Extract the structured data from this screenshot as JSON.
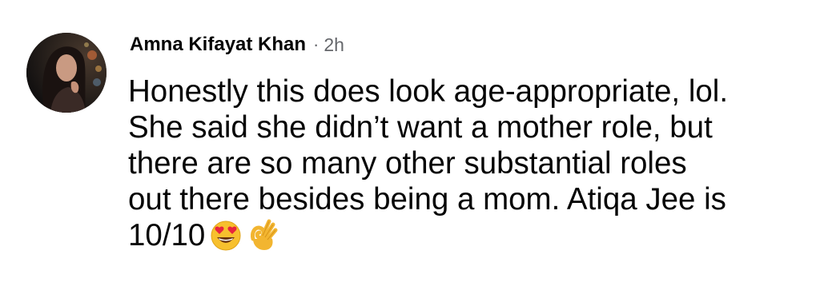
{
  "comment": {
    "author": "Amna Kifayat Khan",
    "separator": "·",
    "time": "2h",
    "lines": [
      "Honestly this does look age-appropriate, lol.",
      "She said she didn’t want a mother role, but",
      "there are so many other substantial roles",
      "out there besides being a mom. Atiqa Jee is",
      "10/10"
    ],
    "emojis": [
      "heart-eyes-emoji",
      "ok-hand-emoji"
    ]
  }
}
